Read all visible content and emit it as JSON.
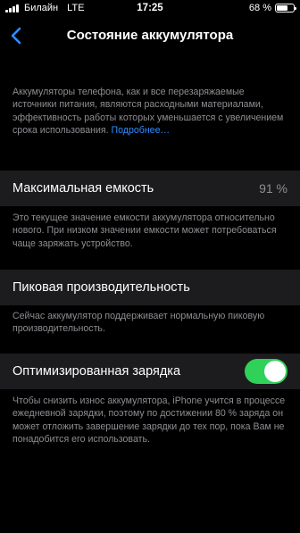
{
  "status_bar": {
    "carrier": "Билайн",
    "network": "LTE",
    "time": "17:25",
    "battery_percent": "68 %",
    "battery_level": 0.68
  },
  "nav": {
    "back_icon": "chevron-left-icon",
    "title": "Состояние аккумулятора"
  },
  "intro": {
    "text": "Аккумуляторы телефона, как и все перезаряжаемые источники питания, являются расходными материалами, эффективность работы которых уменьшается с увеличением срока использования.",
    "link": "Подробнее…"
  },
  "max_capacity": {
    "label": "Максимальная емкость",
    "value": "91 %",
    "footer": "Это текущее значение емкости аккумулятора относительно нового. При низком значении емкости может потребоваться чаще заряжать устройство."
  },
  "peak_performance": {
    "label": "Пиковая производительность",
    "footer": "Сейчас аккумулятор поддерживает нормальную пиковую производительность."
  },
  "optimized_charging": {
    "label": "Оптимизированная зарядка",
    "enabled": true,
    "footer": "Чтобы снизить износ аккумулятора, iPhone учится в процессе ежедневной зарядки, поэтому по достижении 80 % заряда он может отложить завершение зарядки до тех пор, пока Вам не понадобится его использовать."
  },
  "colors": {
    "background": "#000000",
    "cell": "#1c1c1e",
    "secondary_text": "#8e8e93",
    "link": "#2f8cff",
    "toggle_on": "#30d158"
  }
}
